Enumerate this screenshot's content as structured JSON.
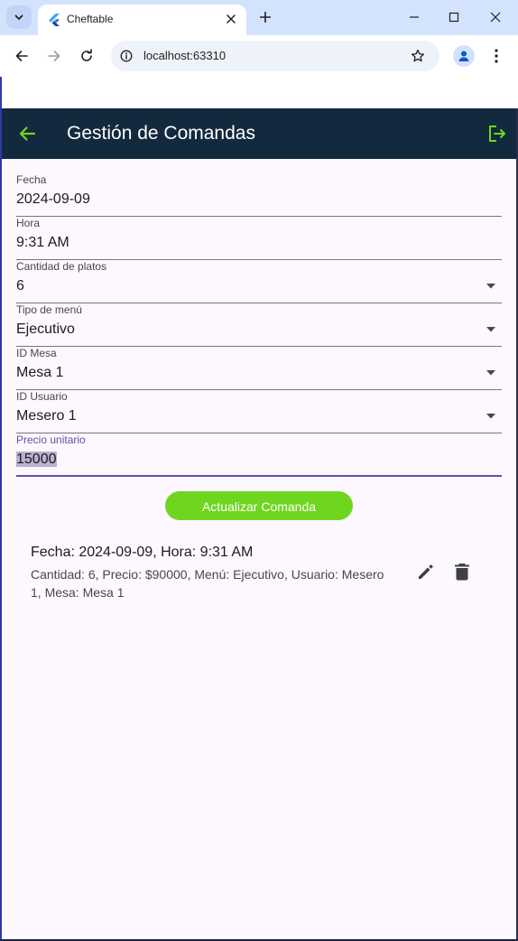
{
  "browser": {
    "tab_title": "Cheftable",
    "url": "localhost:63310"
  },
  "icons": {
    "tab_search": "chevron-down-icon",
    "favicon": "flutter-icon",
    "tab_close": "close-icon",
    "new_tab": "plus-icon",
    "minimize": "minimize-icon",
    "maximize": "maximize-icon",
    "close_window": "close-icon",
    "back": "arrow-left-icon",
    "forward": "arrow-right-icon",
    "reload": "reload-icon",
    "site_info": "info-icon",
    "bookmark": "star-icon",
    "profile": "person-icon",
    "menu": "more-vertical-icon",
    "app_back": "arrow-left-icon",
    "logout": "logout-icon",
    "dropdown": "triangle-down-icon",
    "edit": "pencil-icon",
    "delete": "trash-icon"
  },
  "colors": {
    "appbar": "#13293d",
    "accent": "#6fd61f",
    "focus": "#6750a4",
    "background": "#fdf7ff"
  },
  "app": {
    "title": "Gestión de Comandas"
  },
  "form": {
    "fecha": {
      "label": "Fecha",
      "value": "2024-09-09"
    },
    "hora": {
      "label": "Hora",
      "value": "9:31 AM"
    },
    "cantidad": {
      "label": "Cantidad de platos",
      "value": "6"
    },
    "tipo_menu": {
      "label": "Tipo de menú",
      "value": "Ejecutivo"
    },
    "id_mesa": {
      "label": "ID Mesa",
      "value": "Mesa 1"
    },
    "id_usuario": {
      "label": "ID Usuario",
      "value": "Mesero 1"
    },
    "precio": {
      "label": "Precio unitario",
      "value": "15000"
    },
    "submit_label": "Actualizar Comanda"
  },
  "orders": [
    {
      "title": "Fecha: 2024-09-09, Hora: 9:31 AM",
      "subtitle": "Cantidad: 6, Precio: $90000, Menú: Ejecutivo, Usuario: Mesero 1, Mesa: Mesa 1"
    }
  ]
}
